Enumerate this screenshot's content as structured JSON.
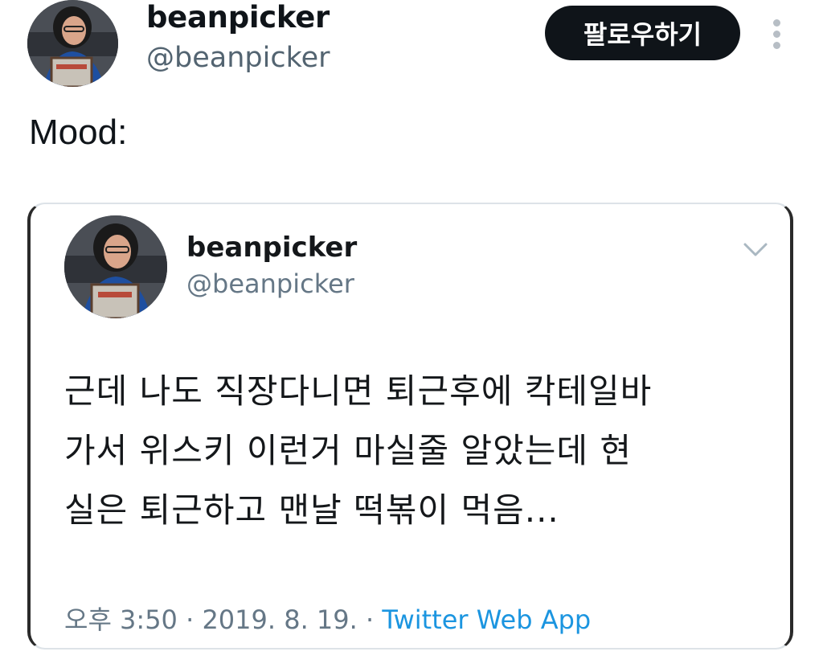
{
  "header": {
    "display_name": "beanpicker",
    "handle": "@beanpicker",
    "follow_label": "팔로우하기",
    "more_icon": "more-vertical-icon"
  },
  "tweet": {
    "text": "Mood:"
  },
  "quoted_tweet": {
    "display_name": "beanpicker",
    "handle": "@beanpicker",
    "menu_icon": "chevron-down-icon",
    "lines": [
      "근데 나도 직장다니면 퇴근후에 칵테일바",
      "가서 위스키 이런거 마실줄 알았는데 현",
      "실은 퇴근하고 맨날 떡볶이 먹음..."
    ],
    "time": "오후 3:50",
    "separator": " · ",
    "date": "2019. 8. 19.",
    "source": "Twitter Web App"
  },
  "colors": {
    "follow_button_bg": "#0f1419",
    "handle_gray": "#536471",
    "link_blue": "#1b95e0"
  }
}
